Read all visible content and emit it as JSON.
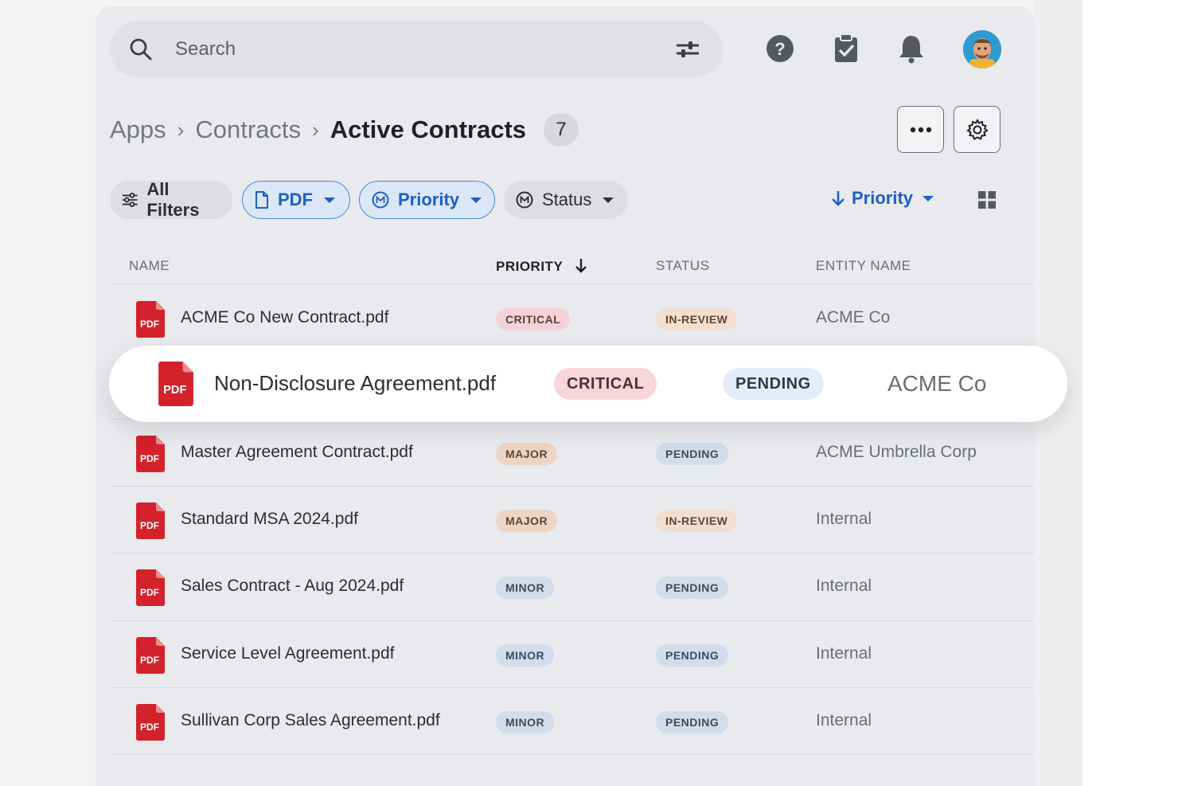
{
  "search": {
    "placeholder": "Search"
  },
  "breadcrumb": {
    "items": [
      "Apps",
      "Contracts"
    ],
    "current": "Active Contracts",
    "count": "7"
  },
  "filters": {
    "all_filters": "All Filters",
    "pdf": "PDF",
    "priority": "Priority",
    "status": "Status"
  },
  "sort": {
    "label": "Priority"
  },
  "table": {
    "columns": {
      "name": "NAME",
      "priority": "PRIORITY",
      "status": "STATUS",
      "entity": "ENTITY NAME"
    },
    "rows": [
      {
        "name": "ACME Co New Contract.pdf",
        "priority": "CRITICAL",
        "status": "IN-REVIEW",
        "entity": "ACME Co"
      },
      {
        "name": "Non-Disclosure Agreement.pdf",
        "priority": "CRITICAL",
        "status": "PENDING",
        "entity": "ACME Co"
      },
      {
        "name": "Master Agreement Contract.pdf",
        "priority": "MAJOR",
        "status": "PENDING",
        "entity": "ACME Umbrella Corp"
      },
      {
        "name": "Standard MSA 2024.pdf",
        "priority": "MAJOR",
        "status": "IN-REVIEW",
        "entity": "Internal"
      },
      {
        "name": "Sales Contract - Aug 2024.pdf",
        "priority": "MINOR",
        "status": "PENDING",
        "entity": "Internal"
      },
      {
        "name": "Service Level Agreement.pdf",
        "priority": "MINOR",
        "status": "PENDING",
        "entity": "Internal"
      },
      {
        "name": "Sullivan Corp Sales Agreement.pdf",
        "priority": "MINOR",
        "status": "PENDING",
        "entity": "Internal"
      }
    ]
  },
  "file_icon_label": "PDF",
  "colors": {
    "accent": "#1d5fc4",
    "pdf_red": "#d3222b",
    "panel": "#e8eaee"
  },
  "icons": [
    "search-icon",
    "tune-icon",
    "help-icon",
    "clipboard-check-icon",
    "bell-icon",
    "more-icon",
    "gear-icon",
    "sliders-icon",
    "file-icon",
    "priority-circle-icon",
    "status-circle-icon",
    "arrow-down-icon",
    "grid-view-icon",
    "pdf-file-icon"
  ]
}
